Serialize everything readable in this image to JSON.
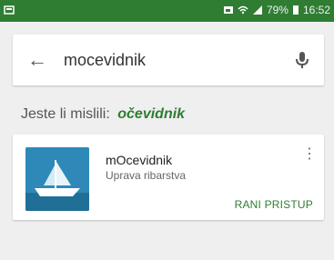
{
  "status_bar": {
    "battery_percent": "79%",
    "time": "16:52",
    "icons": [
      "app-notification-icon",
      "image-icon",
      "wifi-icon",
      "signal-icon",
      "battery-icon"
    ]
  },
  "search": {
    "query": "mocevidnik",
    "back_icon": "back-arrow-icon",
    "mic_icon": "mic-icon"
  },
  "suggestion": {
    "prefix": "Jeste li mislili:",
    "suggested": "očevidnik"
  },
  "result": {
    "app_name": "mOcevidnik",
    "developer": "Uprava ribarstva",
    "action_label": "RANI PRISTUP",
    "menu_icon": "more-vert-icon",
    "icon_name": "boat-app-icon"
  },
  "colors": {
    "accent": "#2e7d32",
    "background": "#efefef",
    "card": "#ffffff"
  }
}
